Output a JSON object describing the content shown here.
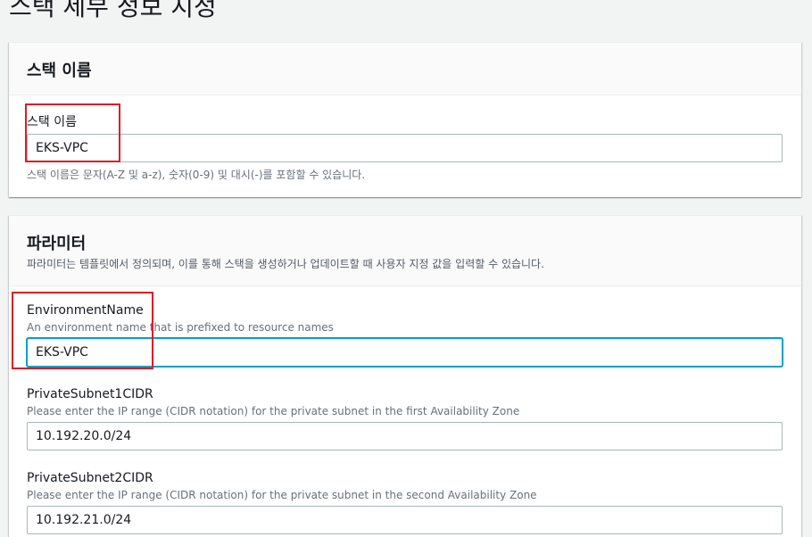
{
  "page": {
    "title": "스택 세부 정보 지정"
  },
  "stack_name_panel": {
    "title": "스택 이름",
    "field_label": "스택 이름",
    "value": "EKS-VPC",
    "hint": "스택 이름은 문자(A-Z 및 a-z), 숫자(0-9) 및 대시(-)를 포함할 수 있습니다."
  },
  "parameters_panel": {
    "title": "파라미터",
    "description": "파라미터는 템플릿에서 정의되며, 이를 통해 스택을 생성하거나 업데이트할 때 사용자 지정 값을 입력할 수 있습니다.",
    "fields": [
      {
        "label": "EnvironmentName",
        "description": "An environment name that is prefixed to resource names",
        "value": "EKS-VPC"
      },
      {
        "label": "PrivateSubnet1CIDR",
        "description": "Please enter the IP range (CIDR notation) for the private subnet in the first Availability Zone",
        "value": "10.192.20.0/24"
      },
      {
        "label": "PrivateSubnet2CIDR",
        "description": "Please enter the IP range (CIDR notation) for the private subnet in the second Availability Zone",
        "value": "10.192.21.0/24"
      }
    ]
  },
  "colors": {
    "annotation_red": "#e01b24",
    "focus_blue": "#00a1c9",
    "background": "#f2f3f3"
  }
}
